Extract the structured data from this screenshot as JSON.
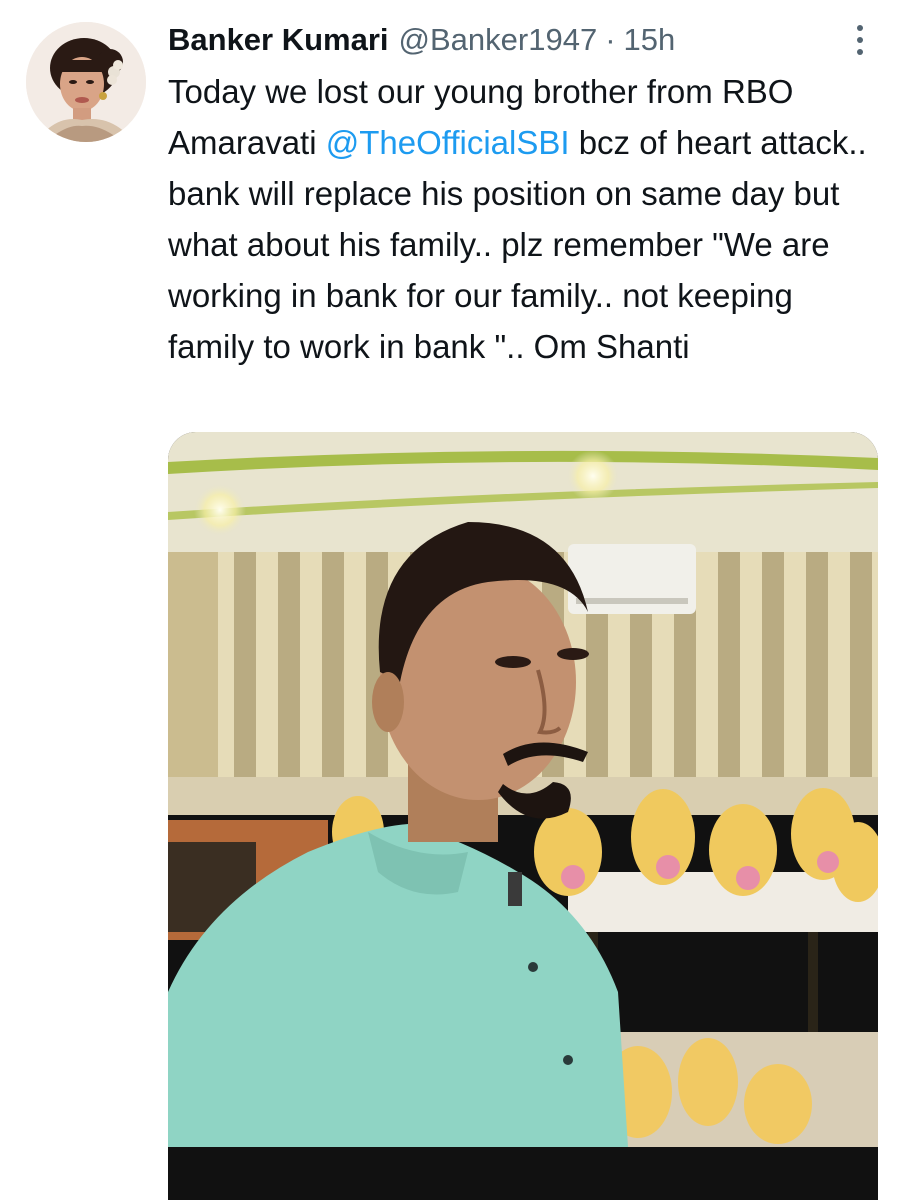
{
  "tweet": {
    "display_name": "Banker Kumari",
    "handle": "@Banker1947",
    "separator": "·",
    "time": "15h",
    "text_before_mention": "Today we lost our young brother from RBO Amaravati ",
    "mention": "@TheOfficialSBI",
    "text_after_mention": " bcz of heart attack.. bank will replace his position on same day but what about his family.. plz remember \"We are working in bank for our family.. not keeping family to work in bank \".. Om Shanti"
  },
  "icons": {
    "more": "more-vertical-icon"
  },
  "colors": {
    "text": "#0f1419",
    "secondary": "#536471",
    "link": "#1d9bf0"
  }
}
